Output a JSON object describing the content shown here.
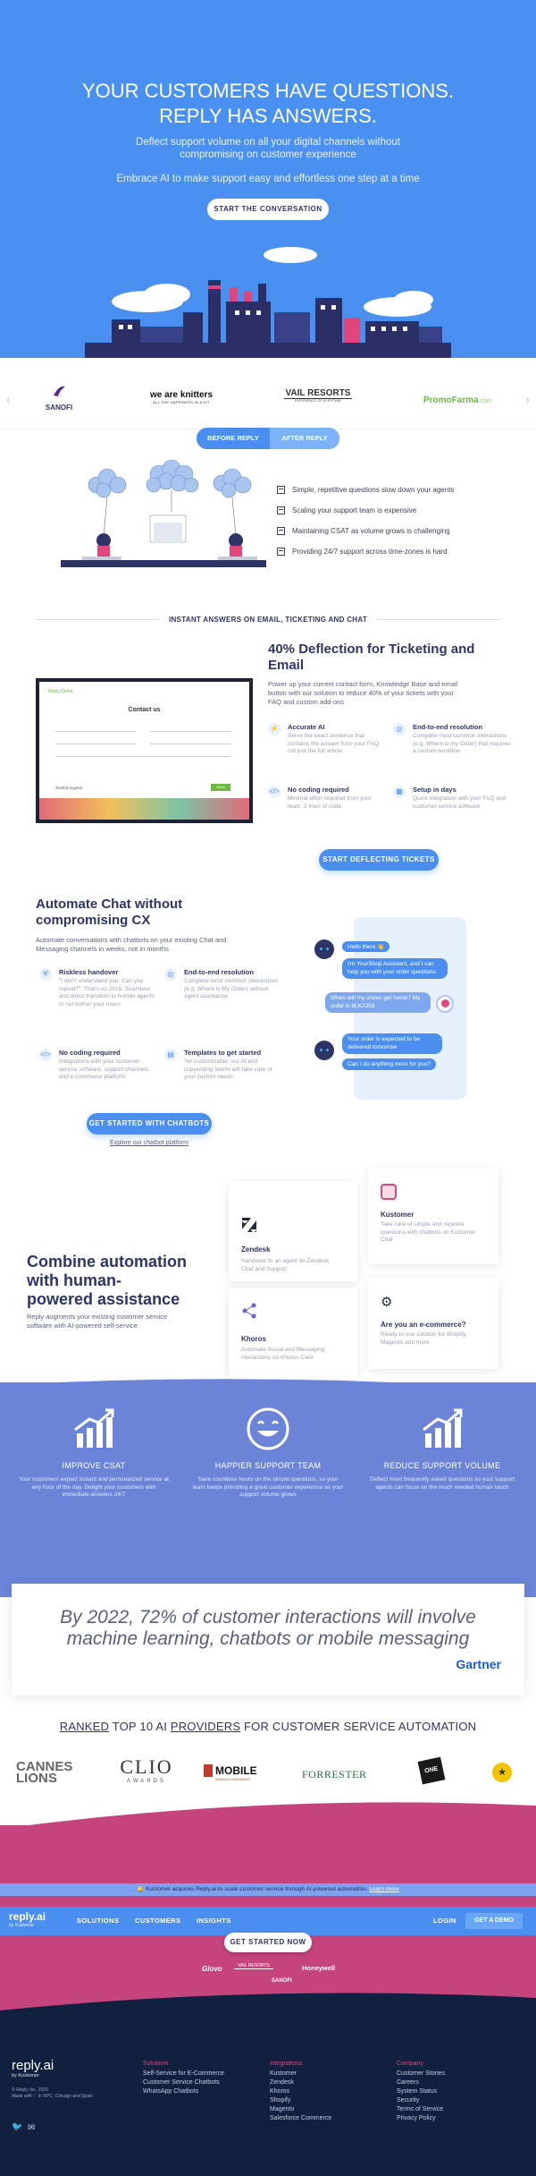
{
  "hero": {
    "title_line1": "YOUR CUSTOMERS HAVE QUESTIONS.",
    "title_line2": "REPLY HAS ANSWERS.",
    "subtitle_line1": "Deflect support volume on all your digital channels without",
    "subtitle_line2": "compromising on customer experience",
    "tagline": "Embrace AI to make support easy and effortless one step at a time",
    "cta": "START THE CONVERSATION",
    "bg_color": "#4a90f0"
  },
  "client_logos": {
    "items": [
      {
        "name": "SANOFI"
      },
      {
        "name": "we are knitters",
        "sub": "ALL THE HAPPINESS IN A KIT"
      },
      {
        "name": "VAIL RESORTS",
        "sub": "EXPERIENCE OF A LIFETIME"
      },
      {
        "name": "PromoFarma",
        "sub": ".com"
      }
    ],
    "prev_icon": "chevron-left-icon",
    "next_icon": "chevron-right-icon"
  },
  "before_after": {
    "before_label": "BEFORE REPLY",
    "after_label": "AFTER REPLY",
    "items": [
      "Simple, repetitive questions slow down your agents",
      "Scaling your support team is expensive",
      "Maintaining CSAT as volume grows is challenging",
      "Providing 24/7 support across time-zones is hard"
    ]
  },
  "ticketing": {
    "section_label": "INSTANT ANSWERS ON EMAIL, TICKETING AND CHAT",
    "title_line1": "40% Deflection for Ticketing and",
    "title_line2": "Email",
    "body_line1": "Power up your current contact form, Knowledge Base and email",
    "body_line2": "button with our solution to reduce 40% of your tickets with your",
    "body_line3": "FAQ and custom add-ons",
    "mock_form": {
      "brand": "Reply Demo",
      "title": "Contact us",
      "footer": "Sumbit request",
      "button": "Send"
    },
    "features": [
      {
        "icon": "bolt-icon",
        "title": "Accurate AI",
        "desc": "Serve the exact sentence that contains the answer from your FAQ, not just the full article"
      },
      {
        "icon": "target-icon",
        "title": "End-to-end resolution",
        "desc": "Complete most common interactions (e.g. Where is my Order) that requires a custom workflow"
      },
      {
        "icon": "code-off-icon",
        "title": "No coding required",
        "desc": "Minimal effort required from your team: 2 lines of code"
      },
      {
        "icon": "calendar-icon",
        "title": "Setup in days",
        "desc": "Quick integration with your FAQ and customer service software"
      }
    ],
    "cta": "START DEFLECTING TICKETS"
  },
  "chat": {
    "title_line1": "Automate Chat without",
    "title_line2": "compromising CX",
    "body_line1": "Automate conversations with chatbots on your existing Chat and",
    "body_line2": "Messaging channels in weeks, not in months",
    "features": [
      {
        "icon": "shield-icon",
        "title": "Riskless handover",
        "desc": "\"I don't understand you. Can you repeat?\". That's so 2016. Seamless and direct transition to human agents to not bother your users"
      },
      {
        "icon": "target-icon",
        "title": "End-to-end resolution",
        "desc": "Complete most common interactions (e.g. Where is My Order) without agent assistance"
      },
      {
        "icon": "code-off-icon",
        "title": "No coding required",
        "desc": "Integrations with your customer service software, support channels and e-commerce platform"
      },
      {
        "icon": "template-icon",
        "title": "Templates to get started",
        "desc": "Yet customizable: our AI and copywriting teams will take care of your custom needs"
      }
    ],
    "messages": [
      {
        "from": "bot",
        "text": "Hello there 👋"
      },
      {
        "from": "bot",
        "text": "I'm YourShop Assistant, and I can help you with your order questions"
      },
      {
        "from": "user",
        "text": "When will my shoes get home? My order is 9LK2356"
      },
      {
        "from": "bot",
        "text": "Your order is expected to be delivered tomorrow"
      },
      {
        "from": "bot",
        "text": "Can I do anything more for you?"
      }
    ],
    "cta": "GET STARTED WITH CHATBOTS",
    "link": "Explore our chatbot platform"
  },
  "combine": {
    "title_line1": "Combine automation",
    "title_line2": "with human-",
    "title_line3": "powered assistance",
    "body_line1": "Reply augments your existing customer service",
    "body_line2": "software with AI-powered self-service",
    "cards": [
      {
        "icon": "zendesk-icon",
        "title": "Zendesk",
        "desc": "Handover to an agent on Zendesk Chat and Support"
      },
      {
        "icon": "kustomer-icon",
        "title": "Kustomer",
        "desc": "Take care of simple and repetive questions with chatbots on Kustomer Chat"
      },
      {
        "icon": "khoros-icon",
        "title": "Khoros",
        "desc": "Automate Social and Messaging interactions on Khoros Care"
      },
      {
        "icon": "gears-icon",
        "title": "Are you an e-commerce?",
        "desc": "Ready to use solution for Shopify, Magento and more"
      }
    ]
  },
  "benefits": {
    "bg_color": "#6b84d8",
    "items": [
      {
        "icon": "growth-chart-icon",
        "title": "IMPROVE CSAT",
        "desc": "Your customers expect instant and personalized service at any hour of the day. Delight your customers with immediate answers 24/7"
      },
      {
        "icon": "smile-icon",
        "title": "HAPPIER SUPPORT TEAM",
        "desc": "Save countless hours on the simple questions, so your team keeps providing a great customer experience as your support volume grows"
      },
      {
        "icon": "growth-chart-icon",
        "title": "REDUCE SUPPORT VOLUME",
        "desc": "Deflect most frequently asked questions so your support agents can focus on the much needed human touch"
      }
    ]
  },
  "quote": {
    "text_line1": "By 2022, 72% of customer interactions will involve",
    "text_line2": "machine learning, chatbots or mobile messaging",
    "source": "Gartner"
  },
  "ranking": {
    "word1": "RANKED",
    "middle": " TOP 10 AI ",
    "word2": "PROVIDERS",
    "end": " FOR CUSTOMER SERVICE AUTOMATION",
    "awards": [
      {
        "name": "CANNES",
        "sub": "LIONS"
      },
      {
        "name": "CLIO",
        "sub": "AWARDS"
      },
      {
        "name": "MOBILE",
        "sub": "WORLD CONGRESS"
      },
      {
        "name": "FORRESTER"
      },
      {
        "name": "ONE"
      },
      {
        "name": "★"
      }
    ]
  },
  "notice": {
    "text": "🔔 Kustomer acquires Reply.ai to scale customer service through AI-powered automation.",
    "link": "Learn more"
  },
  "navbar": {
    "logo": "reply.ai",
    "logo_sub": "by Kustomer",
    "items": [
      "SOLUTIONS",
      "CUSTOMERS",
      "INSIGHTS"
    ],
    "login": "LOGIN",
    "demo": "GET A DEMO"
  },
  "bottom_cta": {
    "button": "GET STARTED NOW",
    "logos": [
      "Glovo",
      "VAIL RESORTS",
      "Honeywell",
      "SANOFI"
    ]
  },
  "footer": {
    "logo": "reply.ai",
    "logo_sub": "by Kustomer",
    "copyright": "© Reply, Inc. 2020",
    "made_with": "Made with ♡ in NYC, Chicago and Spain",
    "columns": [
      {
        "heading": "Solutions",
        "links": [
          "Self-Service for E-Commerce",
          "Customer Service Chatbots",
          "WhatsApp Chatbots"
        ]
      },
      {
        "heading": "Integrations",
        "links": [
          "Kustomer",
          "Zendesk",
          "Khoros",
          "Shopify",
          "Magento",
          "Salesforce Commerce"
        ]
      },
      {
        "heading": "Company",
        "links": [
          "Customer Stories",
          "Careers",
          "System Status",
          "Security",
          "Terms of Service",
          "Privacy Policy"
        ]
      }
    ],
    "social_icons": [
      "twitter-icon",
      "email-icon"
    ],
    "accent_color": "#e0457b"
  }
}
